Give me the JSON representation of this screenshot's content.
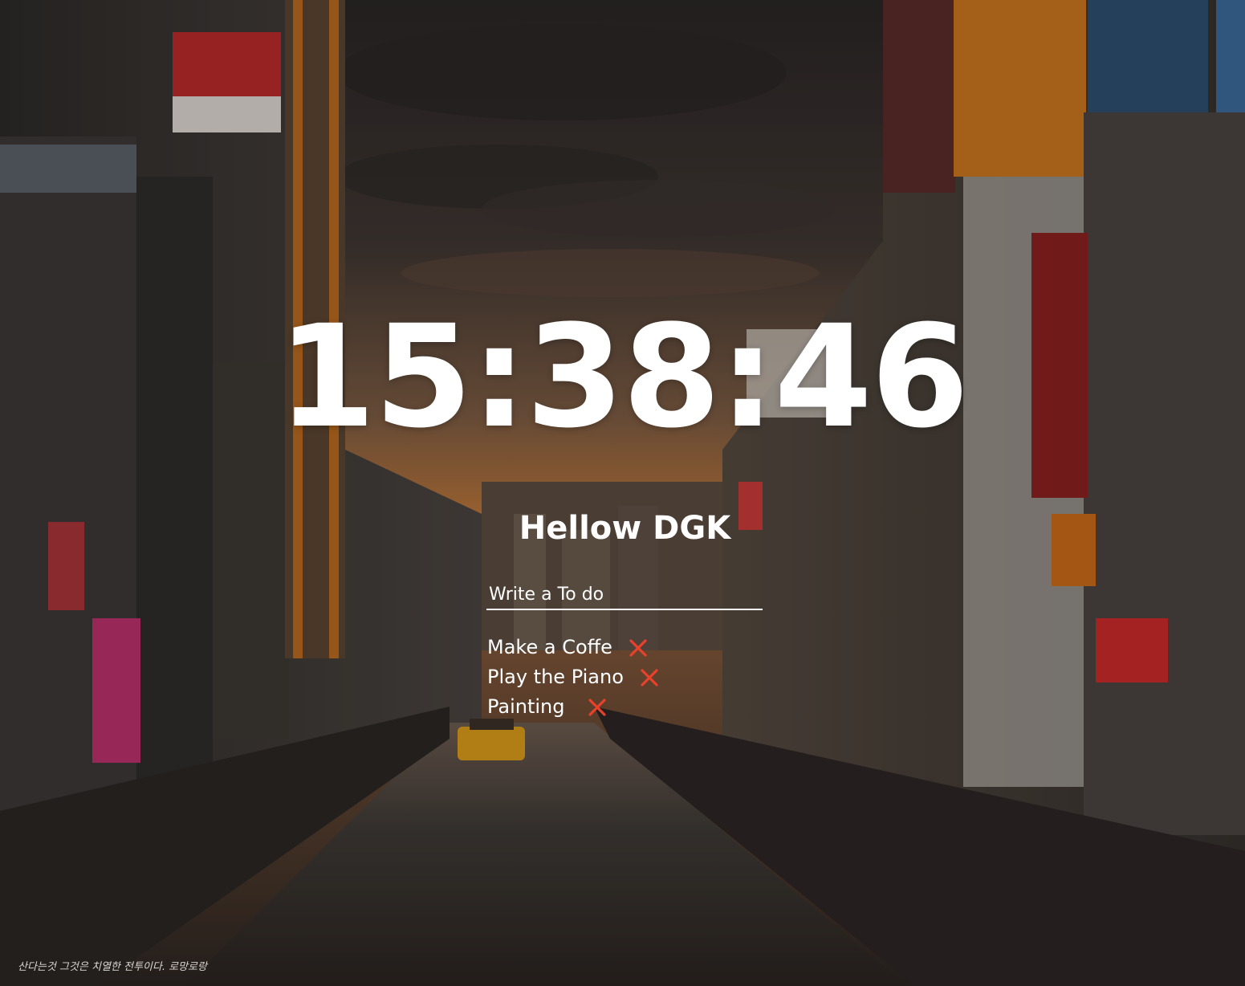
{
  "clock": {
    "time": "15:38:46"
  },
  "greeting": {
    "text": "Hellow DGK"
  },
  "todo_form": {
    "placeholder": "Write a To do"
  },
  "todos": [
    {
      "text": "Make a Coffe",
      "delete_icon": "x-icon"
    },
    {
      "text": "Play the Piano",
      "delete_icon": "x-icon"
    },
    {
      "text": "Painting",
      "delete_icon": "x-icon"
    }
  ],
  "quote": {
    "text": "산다는것 그것은 치열한 전투이다. 로망로랑"
  },
  "colors": {
    "delete_accent": "#e8412c",
    "text": "#ffffff"
  },
  "background": {
    "scene": "osaka-dotonbori-canal-at-dusk"
  }
}
